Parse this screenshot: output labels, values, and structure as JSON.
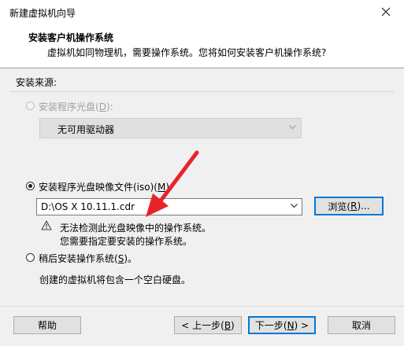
{
  "window": {
    "title": "新建虚拟机向导",
    "close_glyph": "✕"
  },
  "header": {
    "title": "安装客户机操作系统",
    "subtitle": "虚拟机如同物理机，需要操作系统。您将如何安装客户机操作系统?"
  },
  "source": {
    "group_label": "安装来源:",
    "disc_option": {
      "label": "安装程序光盘(",
      "accel": "D",
      "label_end": "):",
      "checked": false,
      "enabled": false
    },
    "drive_select": {
      "value": "无可用驱动器"
    },
    "iso_option": {
      "label": "安装程序光盘映像文件(iso)(",
      "accel": "M",
      "label_end": "):",
      "checked": true,
      "enabled": true
    },
    "iso_path": {
      "value": "D:\\OS X 10.11.1.cdr"
    },
    "browse_button": {
      "label": "浏览(",
      "accel": "R",
      "label_end": ")..."
    },
    "warning": {
      "line1": "无法检测此光盘映像中的操作系统。",
      "line2": "您需要指定要安装的操作系统。"
    },
    "later_option": {
      "label": "稍后安装操作系统(",
      "accel": "S",
      "label_end": ")。",
      "checked": false,
      "enabled": true
    },
    "later_desc": "创建的虚拟机将包含一个空白硬盘。"
  },
  "footer": {
    "help": "帮助",
    "back": {
      "label": "< 上一步(",
      "accel": "B",
      "label_end": ")"
    },
    "next": {
      "label": "下一步(",
      "accel": "N",
      "label_end": ") >"
    },
    "cancel": "取消"
  },
  "colors": {
    "annotation_arrow": "#e8232a",
    "focus_border": "#0078d7",
    "warning_icon": "#444444"
  }
}
